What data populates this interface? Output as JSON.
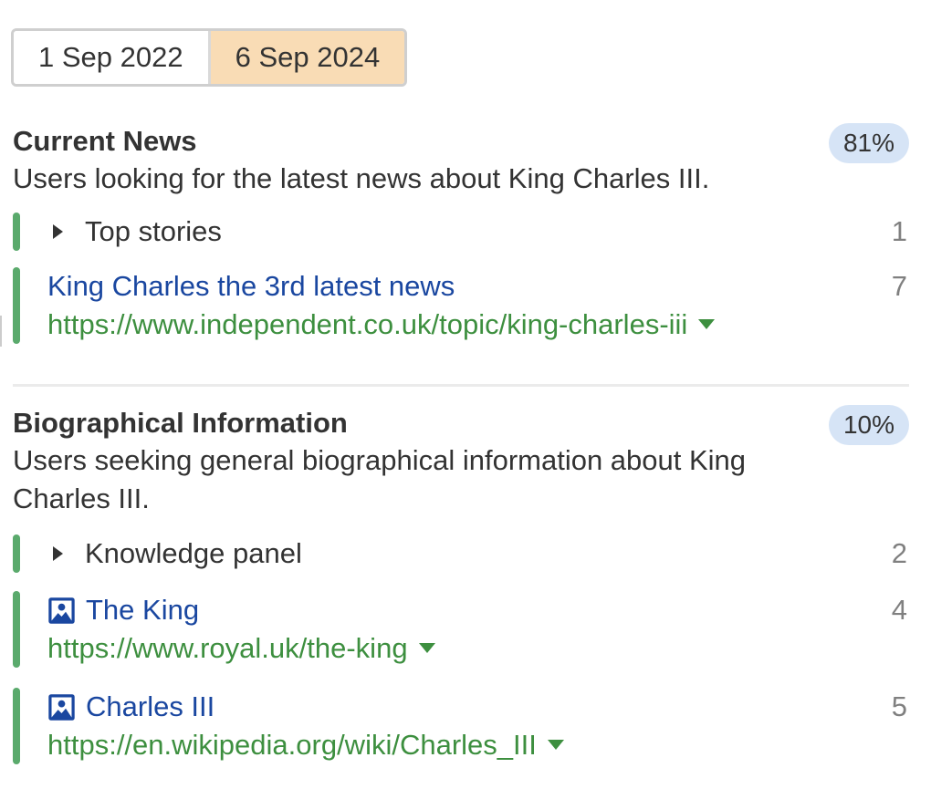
{
  "date_toggle": {
    "options": [
      "1 Sep 2022",
      "6 Sep 2024"
    ],
    "selected": "6 Sep 2024"
  },
  "sections": [
    {
      "title": "Current News",
      "percent": "81%",
      "description": "Users looking for the latest news about King Charles III.",
      "rows": [
        {
          "type": "feature",
          "label": "Top stories",
          "position": "1",
          "icon": "triangle-right-icon"
        },
        {
          "type": "result",
          "title": "King Charles the 3rd latest news",
          "url": "https://www.independent.co.uk/topic/king-charles-iii",
          "position": "7"
        }
      ]
    },
    {
      "title": "Biographical Information",
      "percent": "10%",
      "description": "Users seeking general biographical information about King Charles III.",
      "rows": [
        {
          "type": "feature",
          "label": "Knowledge panel",
          "position": "2",
          "icon": "triangle-right-icon"
        },
        {
          "type": "result",
          "title": "The King",
          "url": "https://www.royal.uk/the-king",
          "position": "4",
          "icon": "image-icon"
        },
        {
          "type": "result",
          "title": "Charles III",
          "url": "https://en.wikipedia.org/wiki/Charles_III",
          "position": "5",
          "icon": "image-icon"
        }
      ]
    }
  ],
  "colors": {
    "accent_bar": "#5aaa6c",
    "link": "#1a47a0",
    "url": "#3d8f3f",
    "badge_bg": "#d6e4f6",
    "selected_date_bg": "#f9dcb5"
  }
}
